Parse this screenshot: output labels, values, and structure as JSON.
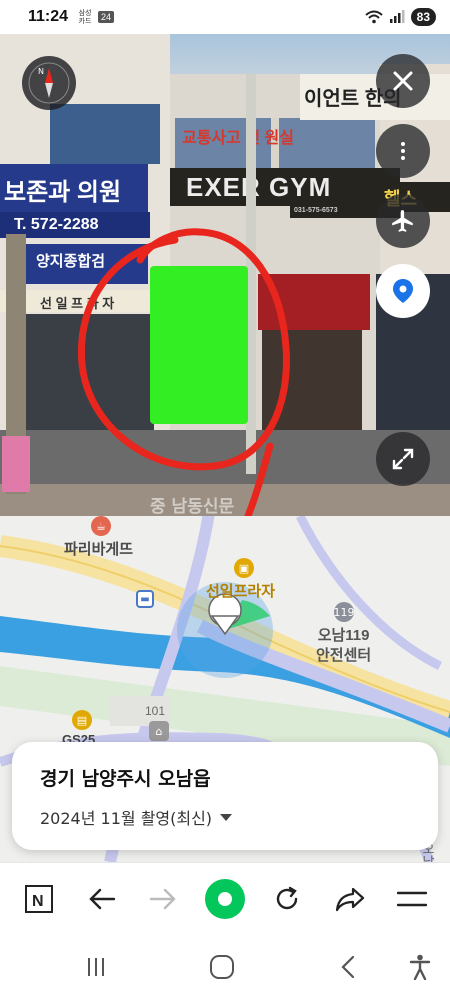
{
  "status_bar": {
    "time": "11:24",
    "card_label": "삼성 카드",
    "badge": "24",
    "battery": "83"
  },
  "streetview": {
    "signs": {
      "clinic": "보존과 의원",
      "phone": "T. 572-2288",
      "hospital": "양지종합검",
      "plaza": "선 일 프 라 자",
      "gym": "EXER GYM",
      "gym_sub": "031-575-6573",
      "red_sign": "교통사고 전 원실",
      "top_sign": "이언트 한의",
      "gym_right": "헬스"
    },
    "watermark": "중 남동신문",
    "redacted_color": "#33ee22",
    "annotation_color": "#e8261d",
    "icons": [
      "compass-icon",
      "close-icon",
      "more-vertical-icon",
      "airplane-icon",
      "location-pin-icon",
      "expand-icon"
    ]
  },
  "map": {
    "labels": {
      "bakery": "파리바게뜨",
      "plaza": "선일프라자",
      "fire_center": "오남119\n안전센터",
      "building_num": "101",
      "gas_station": "GS25",
      "road": "진접오남로"
    },
    "colors": {
      "water": "#3aa0e2",
      "road": "#c7c8ee",
      "road_yellow": "#f6e3a1",
      "green": "#dcebd6"
    }
  },
  "address_card": {
    "title": "경기 남양주시 오남읍",
    "date": "2024년 11월 촬영(최신)"
  },
  "toolbar": {
    "accent": "#03c75a",
    "icons": [
      "naver-n-icon",
      "back-arrow-icon",
      "forward-arrow-icon",
      "home-circle-icon",
      "reload-icon",
      "share-icon",
      "menu-icon"
    ]
  },
  "nav": {
    "icons": [
      "recent-apps-icon",
      "home-icon",
      "back-icon",
      "accessibility-icon"
    ]
  }
}
